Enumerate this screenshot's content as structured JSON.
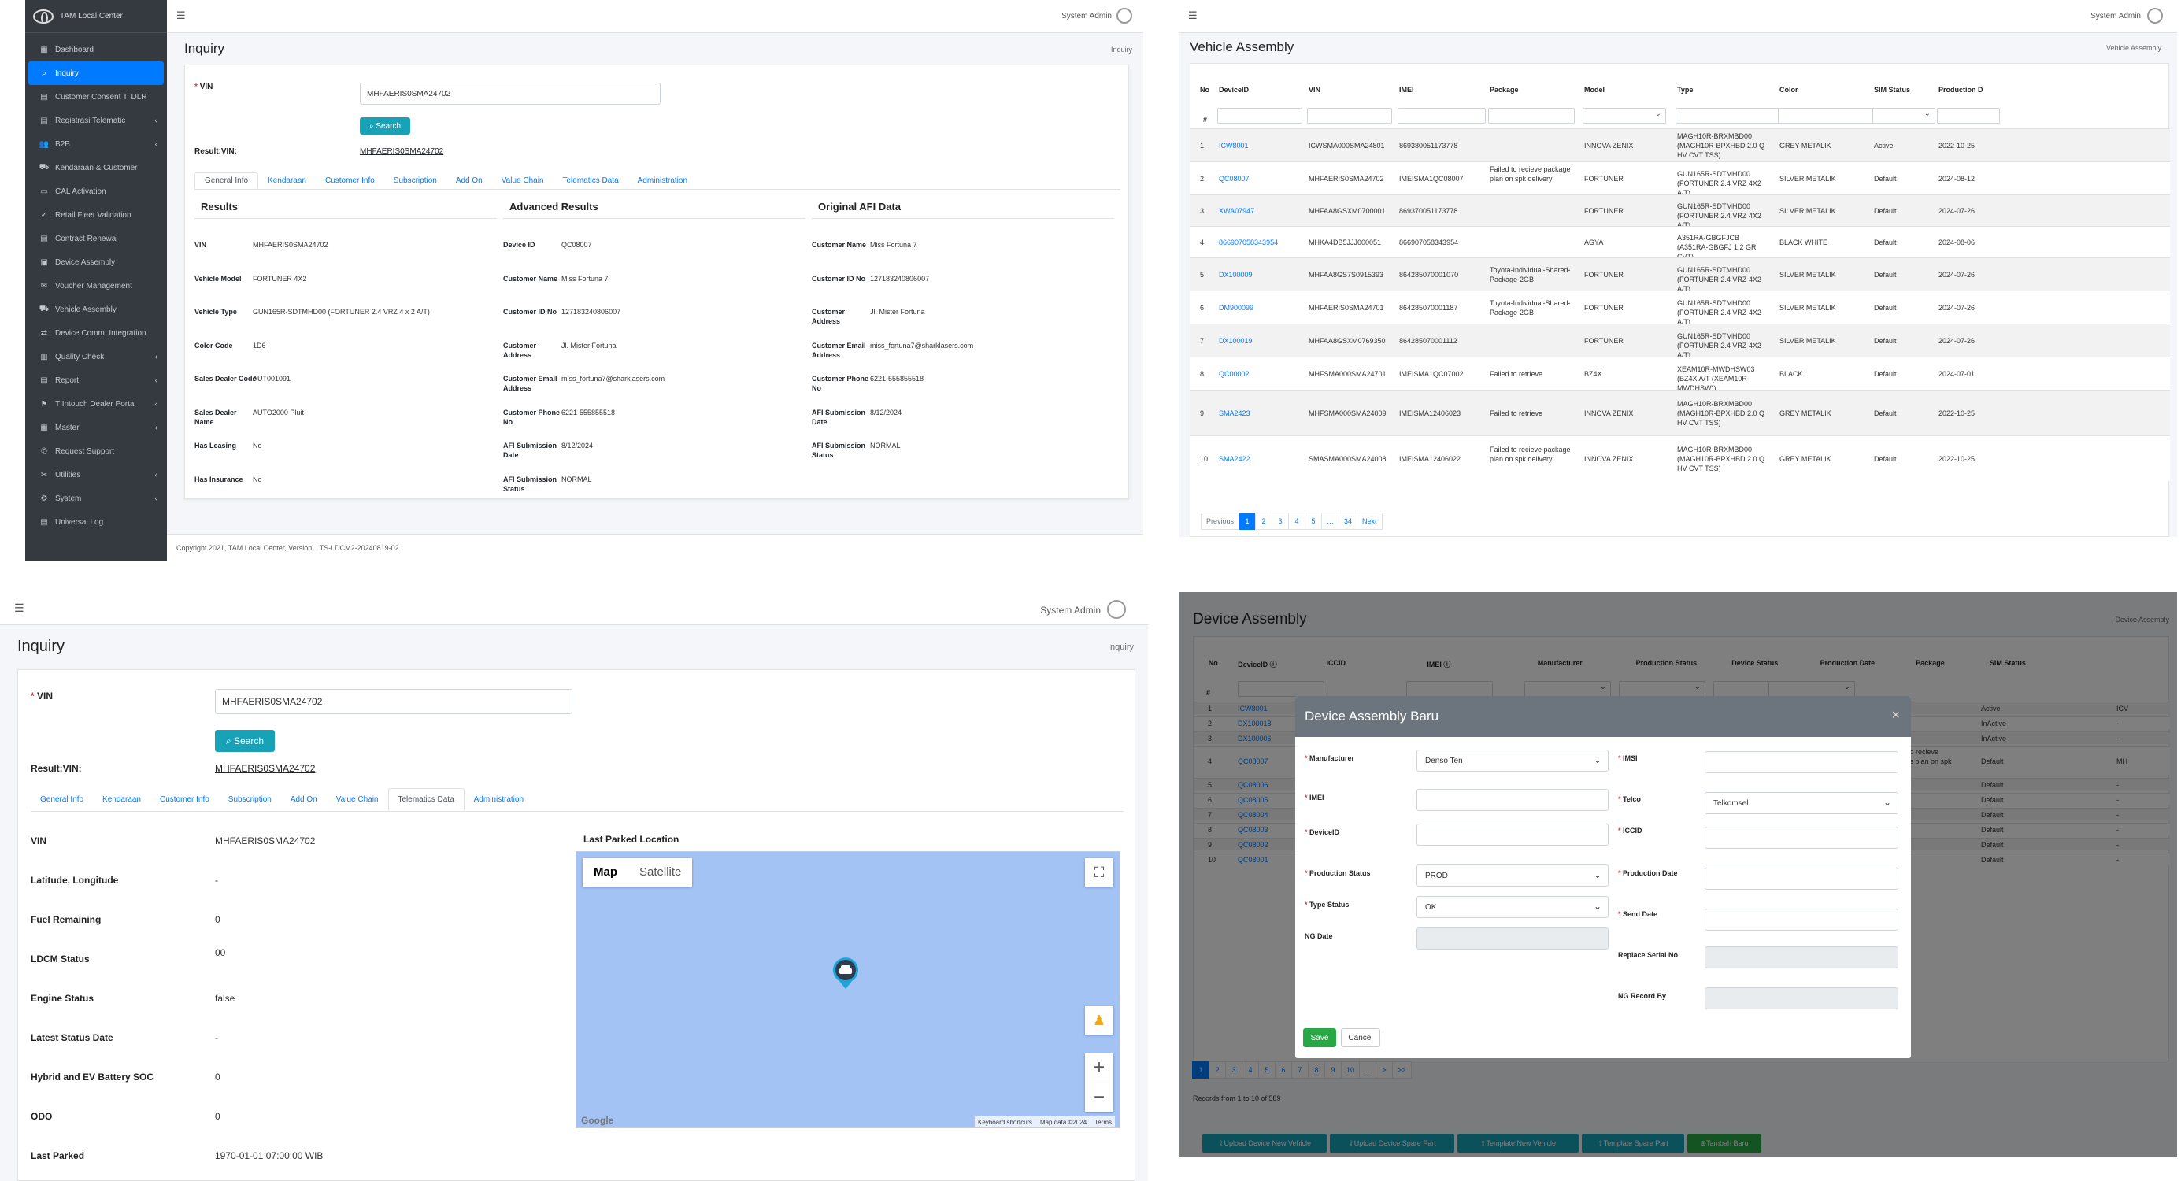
{
  "app": {
    "brand": "TAM Local Center",
    "user": "System Admin",
    "copyright": "Copyright 2021, TAM Local Center, Version. LTS-LDCM2-20240819-02"
  },
  "sidebar": {
    "items": [
      {
        "label": "Dashboard",
        "icon": "dashboard-icon",
        "chev": ""
      },
      {
        "label": "Inquiry",
        "icon": "search-icon",
        "chev": "",
        "active": true
      },
      {
        "label": "Customer Consent T. DLR",
        "icon": "document-icon",
        "chev": ""
      },
      {
        "label": "Registrasi Telematic",
        "icon": "document-icon",
        "chev": "‹"
      },
      {
        "label": "B2B",
        "icon": "users-icon",
        "chev": "‹"
      },
      {
        "label": "Kendaraan & Customer",
        "icon": "car-icon",
        "chev": ""
      },
      {
        "label": "CAL Activation",
        "icon": "card-icon",
        "chev": ""
      },
      {
        "label": "Retail Fleet Validation",
        "icon": "check-icon",
        "chev": ""
      },
      {
        "label": "Contract Renewal",
        "icon": "document-icon",
        "chev": ""
      },
      {
        "label": "Device Assembly",
        "icon": "device-icon",
        "chev": ""
      },
      {
        "label": "Voucher Management",
        "icon": "voucher-icon",
        "chev": ""
      },
      {
        "label": "Vehicle Assembly",
        "icon": "car-icon",
        "chev": ""
      },
      {
        "label": "Device Comm. Integration",
        "icon": "link-icon",
        "chev": ""
      },
      {
        "label": "Quality Check",
        "icon": "chart-icon",
        "chev": "‹"
      },
      {
        "label": "Report",
        "icon": "report-icon",
        "chev": "‹"
      },
      {
        "label": "T Intouch Dealer Portal",
        "icon": "portal-icon",
        "chev": "‹"
      },
      {
        "label": "Master",
        "icon": "table-icon",
        "chev": "‹"
      },
      {
        "label": "Request Support",
        "icon": "support-icon",
        "chev": ""
      },
      {
        "label": "Utilities",
        "icon": "tools-icon",
        "chev": "‹"
      },
      {
        "label": "System",
        "icon": "gear-icon",
        "chev": "‹"
      },
      {
        "label": "Universal Log",
        "icon": "log-icon",
        "chev": ""
      }
    ]
  },
  "inquiry": {
    "title": "Inquiry",
    "breadcrumb": "Inquiry",
    "vin_label": "VIN",
    "vin_value": "MHFAERIS0SMA24702",
    "search_label": "Search",
    "result_label": "Result:VIN:",
    "result_value": "MHFAERIS0SMA24702",
    "tabs": [
      "General Info",
      "Kendaraan",
      "Customer Info",
      "Subscription",
      "Add On",
      "Value Chain",
      "Telematics Data",
      "Administration"
    ],
    "results": {
      "title": "Results",
      "rows": [
        {
          "k": "VIN",
          "v": "MHFAERIS0SMA24702"
        },
        {
          "k": "Vehicle Model",
          "v": "FORTUNER 4X2"
        },
        {
          "k": "Vehicle Type",
          "v": "GUN165R-SDTMHD00 (FORTUNER 2.4 VRZ 4 x 2 A/T)"
        },
        {
          "k": "Color Code",
          "v": "1D6"
        },
        {
          "k": "Sales Dealer Code",
          "v": "AUT001091"
        },
        {
          "k": "Sales Dealer Name",
          "v": "AUTO2000 Pluit"
        },
        {
          "k": "Has Leasing",
          "v": "No"
        },
        {
          "k": "Has Insurance",
          "v": "No"
        }
      ]
    },
    "advanced": {
      "title": "Advanced Results",
      "rows": [
        {
          "k": "Device ID",
          "v": "QC08007"
        },
        {
          "k": "Customer Name",
          "v": "Miss Fortuna 7"
        },
        {
          "k": "Customer ID No",
          "v": "127183240806007"
        },
        {
          "k": "Customer Address",
          "v": "Jl. Mister Fortuna"
        },
        {
          "k": "Customer Email Address",
          "v": "miss_fortuna7@sharklasers.com"
        },
        {
          "k": "Customer Phone No",
          "v": "6221-555855518"
        },
        {
          "k": "AFI Submission Date",
          "v": "8/12/2024"
        },
        {
          "k": "AFI Submission Status",
          "v": "NORMAL"
        }
      ]
    },
    "afi": {
      "title": "Original AFI Data",
      "rows": [
        {
          "k": "Customer Name",
          "v": "Miss Fortuna 7"
        },
        {
          "k": "Customer ID No",
          "v": "127183240806007"
        },
        {
          "k": "Customer Address",
          "v": "Jl. Mister Fortuna"
        },
        {
          "k": "Customer Email Address",
          "v": "miss_fortuna7@sharklasers.com"
        },
        {
          "k": "Customer Phone No",
          "v": "6221-555855518"
        },
        {
          "k": "AFI Submission Date",
          "v": "8/12/2024"
        },
        {
          "k": "AFI Submission Status",
          "v": "NORMAL"
        }
      ]
    }
  },
  "vehicle_assembly": {
    "title": "Vehicle Assembly",
    "breadcrumb": "Vehicle Assembly",
    "columns": [
      "No",
      "DeviceID",
      "VIN",
      "IMEI",
      "Package",
      "Model",
      "Type",
      "Color",
      "SIM Status",
      "Production D"
    ],
    "hash": "#",
    "rows": [
      {
        "no": "1",
        "device": "ICW8001",
        "vin": "ICWSMA000SMA24801",
        "imei": "869380051173778",
        "package": "",
        "model": "INNOVA ZENIX",
        "type": "MAGH10R-BRXMBD00 (MAGH10R-BPXHBD 2.0 Q HV CVT TSS)",
        "color": "GREY METALIK",
        "sim": "Active",
        "prod": "2022-10-25"
      },
      {
        "no": "2",
        "device": "QC08007",
        "vin": "MHFAERIS0SMA24702",
        "imei": "IMEISMA1QC08007",
        "package": "Failed to recieve package plan on spk delivery",
        "model": "FORTUNER",
        "type": "GUN165R-SDTMHD00 (FORTUNER 2.4 VRZ 4X2 A/T)",
        "color": "SILVER METALIK",
        "sim": "Default",
        "prod": "2024-08-12"
      },
      {
        "no": "3",
        "device": "XWA07947",
        "vin": "MHFAA8GSXM0700001",
        "imei": "869370051173778",
        "package": "",
        "model": "FORTUNER",
        "type": "GUN165R-SDTMHD00 (FORTUNER 2.4 VRZ 4X2 A/T)",
        "color": "SILVER METALIK",
        "sim": "Default",
        "prod": "2024-07-26"
      },
      {
        "no": "4",
        "device": "866907058343954",
        "vin": "MHKA4DB5JJJ000051",
        "imei": "866907058343954",
        "package": "",
        "model": "AGYA",
        "type": "A351RA-GBGFJCB (A351RA-GBGFJ 1.2 GR CVT)",
        "color": "BLACK WHITE",
        "sim": "Default",
        "prod": "2024-08-06"
      },
      {
        "no": "5",
        "device": "DX100009",
        "vin": "MHFAA8GS7S0915393",
        "imei": "864285070001070",
        "package": "Toyota-Individual-Shared-Package-2GB",
        "model": "FORTUNER",
        "type": "GUN165R-SDTMHD00 (FORTUNER 2.4 VRZ 4X2 A/T)",
        "color": "SILVER METALIK",
        "sim": "Default",
        "prod": "2024-07-26"
      },
      {
        "no": "6",
        "device": "DM900099",
        "vin": "MHFAERIS0SMA24701",
        "imei": "864285070001187",
        "package": "Toyota-Individual-Shared-Package-2GB",
        "model": "FORTUNER",
        "type": "GUN165R-SDTMHD00 (FORTUNER 2.4 VRZ 4X2 A/T)",
        "color": "SILVER METALIK",
        "sim": "Default",
        "prod": "2024-07-26"
      },
      {
        "no": "7",
        "device": "DX100019",
        "vin": "MHFAA8GSXM0769350",
        "imei": "864285070001112",
        "package": "",
        "model": "FORTUNER",
        "type": "GUN165R-SDTMHD00 (FORTUNER 2.4 VRZ 4X2 A/T)",
        "color": "SILVER METALIK",
        "sim": "Default",
        "prod": "2024-07-26"
      },
      {
        "no": "8",
        "device": "QC00002",
        "vin": "MHFSMA000SMA24701",
        "imei": "IMEISMA1QC07002",
        "package": "Failed to retrieve",
        "model": "BZ4X",
        "type": "XEAM10R-MWDHSW03 (BZ4X A/T (XEAM10R-MWDHSW))",
        "color": "BLACK",
        "sim": "Default",
        "prod": "2024-07-01"
      },
      {
        "no": "9",
        "device": "SMA2423",
        "vin": "MHFSMA000SMA24009",
        "imei": "IMEISMA12406023",
        "package": "Failed to retrieve",
        "model": "INNOVA ZENIX",
        "type": "MAGH10R-BRXMBD00 (MAGH10R-BPXHBD 2.0 Q HV CVT TSS)",
        "color": "GREY METALIK",
        "sim": "Default",
        "prod": "2022-10-25"
      },
      {
        "no": "10",
        "device": "SMA2422",
        "vin": "SMASMA000SMA24008",
        "imei": "IMEISMA12406022",
        "package": "Failed to recieve package plan on spk delivery",
        "model": "INNOVA ZENIX",
        "type": "MAGH10R-BRXMBD00 (MAGH10R-BPXHBD 2.0 Q HV CVT TSS)",
        "color": "GREY METALIK",
        "sim": "Default",
        "prod": "2022-10-25"
      }
    ],
    "pagination": [
      "Previous",
      "1",
      "2",
      "3",
      "4",
      "5",
      "…",
      "34",
      "Next"
    ]
  },
  "telematics": {
    "rows": [
      {
        "k": "VIN",
        "v": "MHFAERIS0SMA24702"
      },
      {
        "k": "Latitude, Longitude",
        "v": "-"
      },
      {
        "k": "Fuel Remaining",
        "v": "0"
      },
      {
        "k": "LDCM Status",
        "v": "00"
      },
      {
        "k": "Engine Status",
        "v": "false"
      },
      {
        "k": "Latest Status Date",
        "v": "-"
      },
      {
        "k": "Hybrid and EV Battery SOC",
        "v": "0"
      },
      {
        "k": "ODO",
        "v": "0"
      },
      {
        "k": "Last Parked",
        "v": "1970-01-01 07:00:00 WIB"
      }
    ],
    "map_title": "Last Parked Location",
    "map_tab": "Map",
    "satellite_tab": "Satellite",
    "google": "Google",
    "shortcuts": "Keyboard shortcuts",
    "mapdata": "Map data ©2024",
    "terms": "Terms"
  },
  "device_assembly": {
    "title": "Device Assembly",
    "breadcrumb": "Device Assembly",
    "columns": [
      "No",
      "DeviceID ⓘ",
      "ICCID",
      "IMEI ⓘ",
      "Manufacturer",
      "Production Status",
      "Device Status",
      "Production Date",
      "Package",
      "SIM Status"
    ],
    "rows": [
      {
        "no": "1",
        "device": "ICW8001",
        "pkg": "",
        "sim": "Active",
        "extra": "ICV"
      },
      {
        "no": "2",
        "device": "DX100018",
        "pkg": "",
        "sim": "InActive",
        "extra": "-"
      },
      {
        "no": "3",
        "device": "DX100006",
        "pkg": "",
        "sim": "InActive",
        "extra": "-"
      },
      {
        "no": "4",
        "device": "QC08007",
        "pkg": "Failed to recieve package plan on spk delivery",
        "sim": "Default",
        "extra": "MH"
      },
      {
        "no": "5",
        "device": "QC08006",
        "pkg": "",
        "sim": "Default",
        "extra": "-"
      },
      {
        "no": "6",
        "device": "QC08005",
        "pkg": "",
        "sim": "Default",
        "extra": "-"
      },
      {
        "no": "7",
        "device": "QC08004",
        "pkg": "",
        "sim": "Default",
        "extra": "-"
      },
      {
        "no": "8",
        "device": "QC08003",
        "pkg": "",
        "sim": "Default",
        "extra": "-"
      },
      {
        "no": "9",
        "device": "QC08002",
        "pkg": "",
        "sim": "Default",
        "extra": "-"
      },
      {
        "no": "10",
        "device": "QC08001",
        "pkg": "",
        "sim": "Default",
        "extra": "-"
      }
    ],
    "pagination": [
      "1",
      "2",
      "3",
      "4",
      "5",
      "6",
      "7",
      "8",
      "9",
      "10",
      "..",
      ">",
      ">>"
    ],
    "records": "Records from 1 to 10 of 589",
    "buttons": [
      "Upload Device New Vehicle",
      "Upload Device Spare Part",
      "Template New Vehicle",
      "Template Spare Part",
      "Tambah Baru"
    ],
    "modal": {
      "title": "Device Assembly Baru",
      "close": "×",
      "manufacturer_label": "Manufacturer",
      "manufacturer_value": "Denso Ten",
      "imei_label": "IMEI",
      "deviceid_label": "DeviceID",
      "prod_status_label": "Production Status",
      "prod_status_value": "PROD",
      "type_status_label": "Type Status",
      "type_status_value": "OK",
      "ng_date_label": "NG Date",
      "imsi_label": "IMSI",
      "telco_label": "Telco",
      "telco_value": "Telkomsel",
      "iccid_label": "ICCID",
      "prod_date_label": "Production Date",
      "send_date_label": "Send Date",
      "replace_label": "Replace Serial No",
      "ng_record_label": "NG Record By",
      "save": "Save",
      "cancel": "Cancel"
    }
  },
  "colors": {
    "primary": "#007bff",
    "info": "#17a2b8",
    "success": "#28a745",
    "sidebar": "#343a40"
  }
}
